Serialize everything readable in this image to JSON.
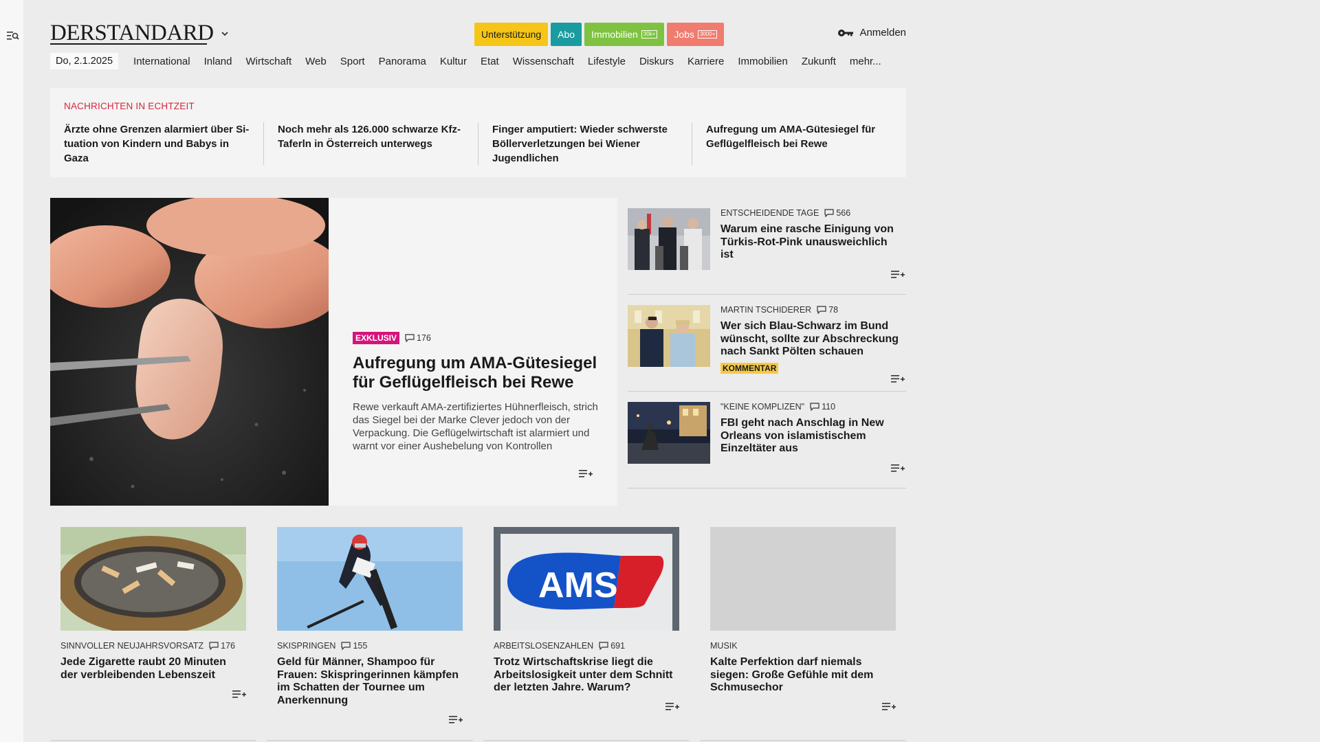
{
  "header": {
    "logo": "DERSTANDARD",
    "buttons": [
      {
        "label": "Unterstützung",
        "color": "#f5c518",
        "text_color": "#1a1a1a",
        "badge": ""
      },
      {
        "label": "Abo",
        "color": "#1a9ba0",
        "text_color": "#ffffff",
        "badge": ""
      },
      {
        "label": "Immobilien",
        "color": "#7fc241",
        "text_color": "#ffffff",
        "badge": "30k+"
      },
      {
        "label": "Jobs",
        "color": "#ef7c6f",
        "text_color": "#ffffff",
        "badge": "3000+"
      }
    ],
    "login_label": "Anmelden"
  },
  "nav": {
    "date": "Do, 2.1.2025",
    "items": [
      "International",
      "Inland",
      "Wirtschaft",
      "Web",
      "Sport",
      "Panorama",
      "Kultur",
      "Etat",
      "Wissenschaft",
      "Lifestyle",
      "Diskurs",
      "Karriere",
      "Immobilien",
      "Zukunft",
      "mehr..."
    ]
  },
  "ticker": {
    "label": "NACHRICHTEN IN ECHTZEIT",
    "items": [
      "Ärzte ohne Grenzen alarmiert über Si­tuation von Kindern und Babys in Gaza",
      "Noch mehr als 126.000 schwarze Kfz-Taferln in Österreich unterwegs",
      "Finger amputiert: Wieder schwerste Böllerverletzungen bei Wiener Jugendlichen",
      "Aufregung um AMA-Gütesiegel für Geflügelfleisch bei Rewe"
    ]
  },
  "lead": {
    "tag": "EXKLUSIV",
    "comments": "176",
    "title": "Aufregung um AMA-Gütesiegel für Geflügelfleisch bei Rewe",
    "text": "Rewe verkauft AMA-zertifiziertes Hühnerfleisch, strich das Siegel bei der Marke Clever jedoch von der Verpackung. Die Geflügelwirtschaft ist alarmiert und warnt vor einer Aushebelung von Kontrollen"
  },
  "side": [
    {
      "kicker": "ENTSCHEIDENDE TAGE",
      "comments": "566",
      "title": "Warum eine rasche Einigung von Türkis-Rot-Pink unausweichlich ist",
      "badge": ""
    },
    {
      "kicker": "MARTIN TSCHIDERER",
      "comments": "78",
      "title": "Wer sich Blau-Schwarz im Bund wünscht, sollte zur Abschreckung nach Sankt Pölten schauen",
      "badge": "KOMMENTAR"
    },
    {
      "kicker": "\"KEINE KOMPLIZEN\"",
      "comments": "110",
      "title": "FBI geht nach Anschlag in New Orleans von islamistischem Einzeltäter aus",
      "badge": ""
    }
  ],
  "cards": [
    {
      "kicker": "SINNVOLLER NEUJAHRSVORSATZ",
      "comments": "176",
      "title": "Jede Zigarette raubt 20 Minuten der verbleibenden Lebenszeit"
    },
    {
      "kicker": "SKISPRINGEN",
      "comments": "155",
      "title": "Geld für Männer, Shampoo für Frauen: Skispringerinnen kämpfen im Schatten der Tournee um Anerkennung"
    },
    {
      "kicker": "ARBEITSLOSENZAHLEN",
      "comments": "691",
      "title": "Trotz Wirtschaftskrise liegt die Arbeitslosigkeit unter dem Schnitt der letzten Jahre. Warum?"
    },
    {
      "kicker": "MUSIK",
      "comments": "",
      "title": "Kalte Perfektion darf niemals siegen: Große Gefühle mit dem Schmusechor"
    }
  ],
  "images": {
    "ams_logo_text": "AMS"
  },
  "icons": [
    "search-menu-icon",
    "chevron-down-icon",
    "key-icon",
    "comment-icon",
    "add-to-list-icon"
  ]
}
